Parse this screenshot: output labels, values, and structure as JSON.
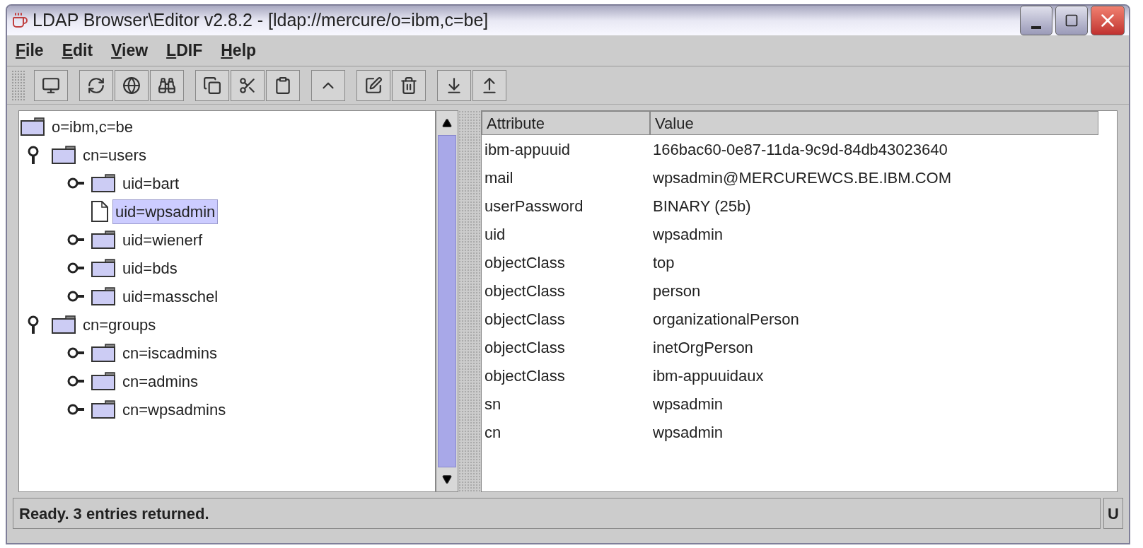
{
  "window": {
    "title": "LDAP Browser\\Editor v2.8.2 - [ldap://mercure/o=ibm,c=be]"
  },
  "menu": [
    "File",
    "Edit",
    "View",
    "LDIF",
    "Help"
  ],
  "toolbar": [
    [
      {
        "kind": "monitor"
      }
    ],
    [
      {
        "kind": "refresh"
      },
      {
        "kind": "globe"
      },
      {
        "kind": "search"
      }
    ],
    [
      {
        "kind": "copy"
      },
      {
        "kind": "cut"
      },
      {
        "kind": "paste"
      }
    ],
    [
      {
        "kind": "up"
      }
    ],
    [
      {
        "kind": "edit"
      },
      {
        "kind": "delete"
      }
    ],
    [
      {
        "kind": "import"
      },
      {
        "kind": "export"
      }
    ]
  ],
  "tree": [
    {
      "label": "o=ibm,c=be",
      "kind": "folder",
      "selected": false,
      "children": [
        {
          "label": "cn=users",
          "kind": "folder",
          "expanded": true,
          "selected": false,
          "children": [
            {
              "label": "uid=bart",
              "kind": "folder",
              "expanded": false,
              "selected": false
            },
            {
              "label": "uid=wpsadmin",
              "kind": "leaf",
              "selected": true
            },
            {
              "label": "uid=wienerf",
              "kind": "folder",
              "expanded": false,
              "selected": false
            },
            {
              "label": "uid=bds",
              "kind": "folder",
              "expanded": false,
              "selected": false
            },
            {
              "label": "uid=masschel",
              "kind": "folder",
              "expanded": false,
              "selected": false
            }
          ]
        },
        {
          "label": "cn=groups",
          "kind": "folder",
          "expanded": true,
          "selected": false,
          "children": [
            {
              "label": "cn=iscadmins",
              "kind": "folder",
              "expanded": false,
              "selected": false
            },
            {
              "label": "cn=admins",
              "kind": "folder",
              "expanded": false,
              "selected": false
            },
            {
              "label": "cn=wpsadmins",
              "kind": "folder",
              "expanded": false,
              "selected": false
            }
          ]
        }
      ]
    }
  ],
  "table": {
    "columns": [
      "Attribute",
      "Value"
    ],
    "rows": [
      [
        "ibm-appuuid",
        "166bac60-0e87-11da-9c9d-84db43023640"
      ],
      [
        "mail",
        "wpsadmin@MERCUREWCS.BE.IBM.COM"
      ],
      [
        "userPassword",
        "BINARY (25b)"
      ],
      [
        "uid",
        "wpsadmin"
      ],
      [
        "objectClass",
        "top"
      ],
      [
        "objectClass",
        "person"
      ],
      [
        "objectClass",
        "organizationalPerson"
      ],
      [
        "objectClass",
        "inetOrgPerson"
      ],
      [
        "objectClass",
        "ibm-appuuidaux"
      ],
      [
        "sn",
        "wpsadmin"
      ],
      [
        "cn",
        "wpsadmin"
      ]
    ]
  },
  "status_bar": {
    "text": "Ready. 3 entries returned.",
    "indicator": "U"
  }
}
